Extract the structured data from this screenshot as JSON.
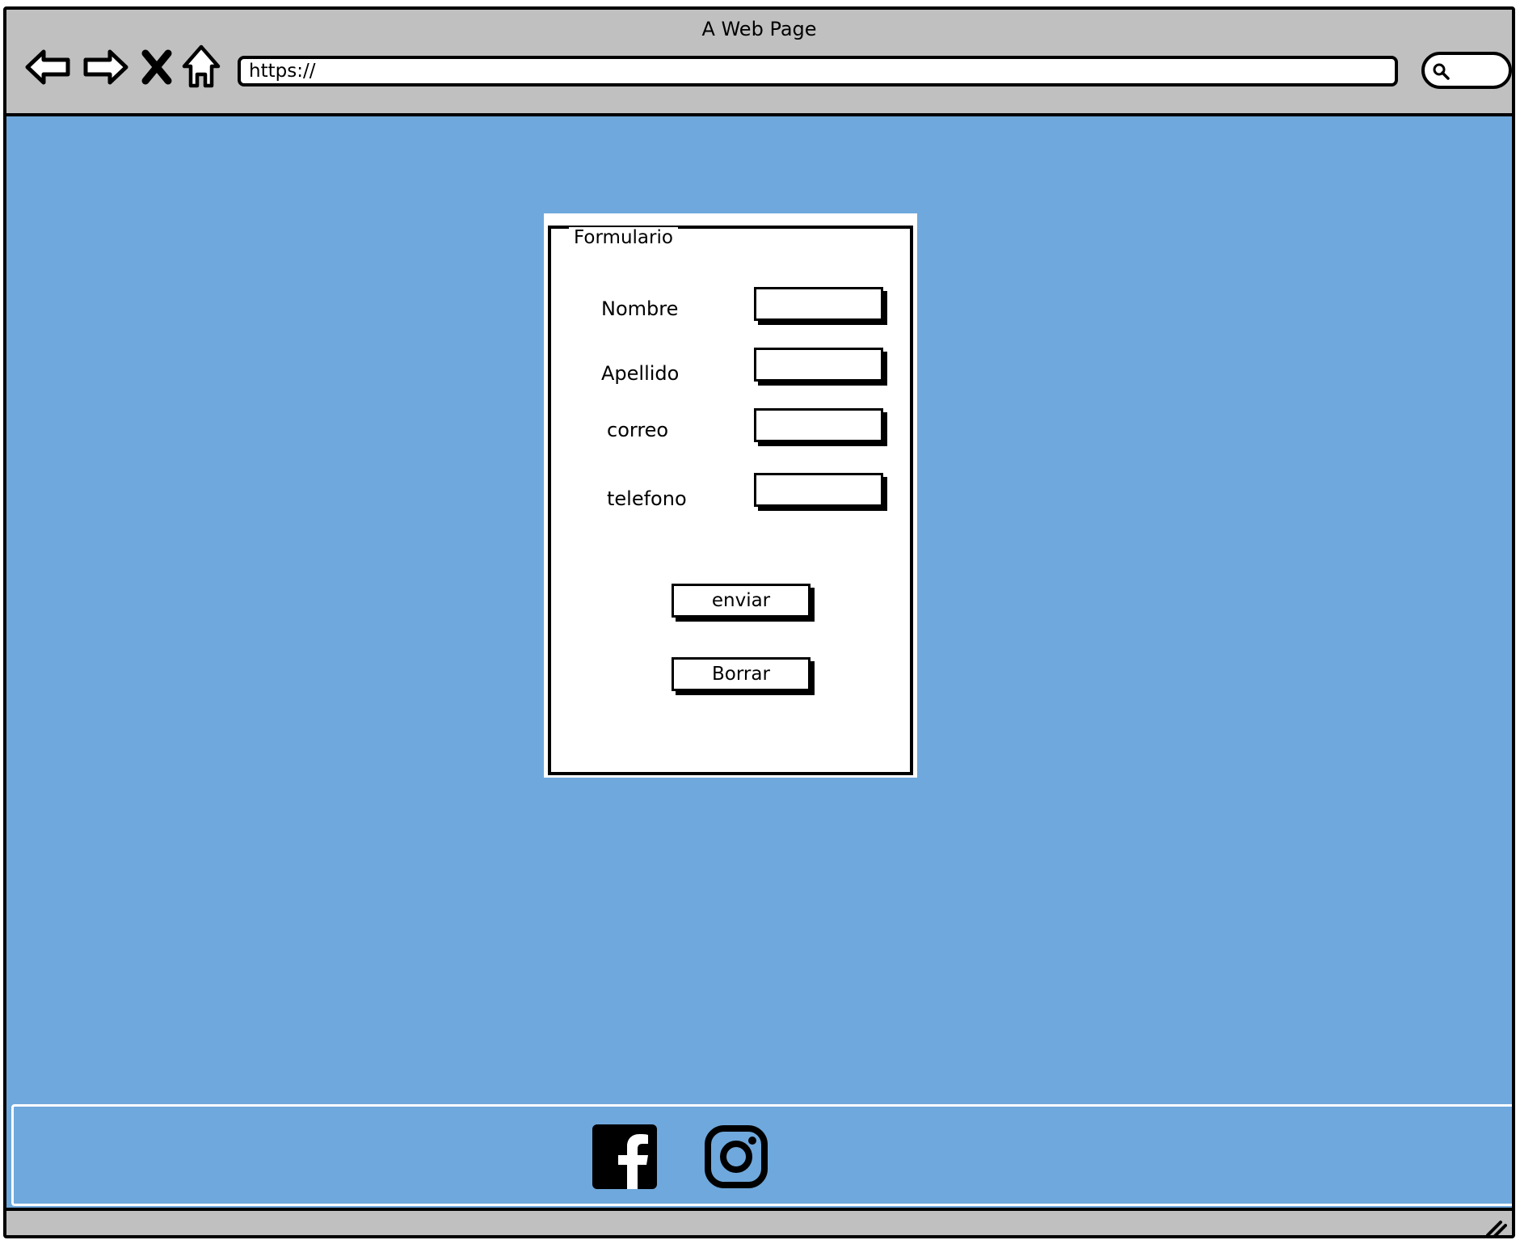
{
  "window": {
    "title": "A Web Page"
  },
  "toolbar": {
    "back_icon": "back-arrow-icon",
    "forward_icon": "forward-arrow-icon",
    "stop_icon": "close-x-icon",
    "home_icon": "home-icon",
    "url": "https://",
    "search_icon": "search-icon"
  },
  "form": {
    "legend": "Formulario",
    "fields": [
      {
        "label": "Nombre",
        "value": ""
      },
      {
        "label": "Apellido",
        "value": ""
      },
      {
        "label": "correo",
        "value": ""
      },
      {
        "label": "telefono",
        "value": ""
      }
    ],
    "submit_label": "enviar",
    "reset_label": "Borrar"
  },
  "footer": {
    "social": [
      {
        "name": "facebook-icon"
      },
      {
        "name": "instagram-icon"
      }
    ]
  },
  "colors": {
    "chrome": "#c0c0c0",
    "content_background": "#6fa8dc",
    "panel": "#ffffff",
    "ink": "#000000"
  }
}
